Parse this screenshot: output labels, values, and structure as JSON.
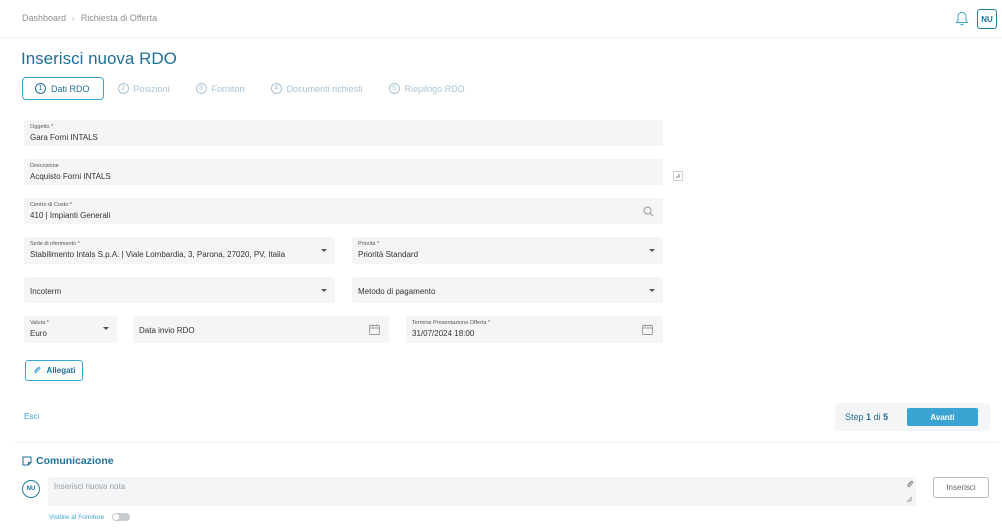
{
  "breadcrumb": {
    "home": "Dashboard",
    "separator": "›",
    "current": "Richiesta di Offerta"
  },
  "user": {
    "initials": "NU"
  },
  "page_title": "Inserisci nuova RDO",
  "steps": [
    {
      "num": "1",
      "label": "Dati RDO"
    },
    {
      "num": "2",
      "label": "Posizioni"
    },
    {
      "num": "3",
      "label": "Fornitori"
    },
    {
      "num": "4",
      "label": "Documenti richiesti"
    },
    {
      "num": "5",
      "label": "Riepilogo RDO"
    }
  ],
  "form": {
    "oggetto": {
      "label": "Oggetto *",
      "value": "Gara Forni INTALS"
    },
    "descrizione": {
      "label": "Descrizione",
      "value": "Acquisto Forni INTALS"
    },
    "centro_costo": {
      "label": "Centro di Costo *",
      "value": "410  |  Impianti Generali"
    },
    "sede": {
      "label": "Sede di riferimento *",
      "value": "Stabilimento Intals S.p.A.   |   Viale Lombardia, 3, Parona, 27020, PV, Italia"
    },
    "priorita": {
      "label": "Priorità *",
      "value": "Priorità Standard"
    },
    "incoterm": {
      "placeholder": "Incoterm"
    },
    "metodo_pagamento": {
      "placeholder": "Metodo di pagamento"
    },
    "valuta": {
      "label": "Valuta *",
      "value": "Euro"
    },
    "data_invio": {
      "placeholder": "Data invio RDO"
    },
    "termine": {
      "label": "Termine Presentazione Offerta *",
      "value": "31/07/2024 18:00"
    }
  },
  "allegati_label": "Allegati",
  "esci_label": "Esci",
  "footer_step": {
    "prefix": "Step",
    "current": "1",
    "middle": "di",
    "total": "5"
  },
  "avanti_label": "Avanti",
  "comunicazione": {
    "title": "Comunicazione",
    "placeholder": "Inserisci nuova nota",
    "inserisci_label": "Inserisci",
    "visibile_label": "Visibile al Fornitore",
    "visibile_enabled": false
  },
  "colors": {
    "accent": "#3ba4d3",
    "title": "#1f6f96",
    "field_bg": "#f3f5f6"
  }
}
